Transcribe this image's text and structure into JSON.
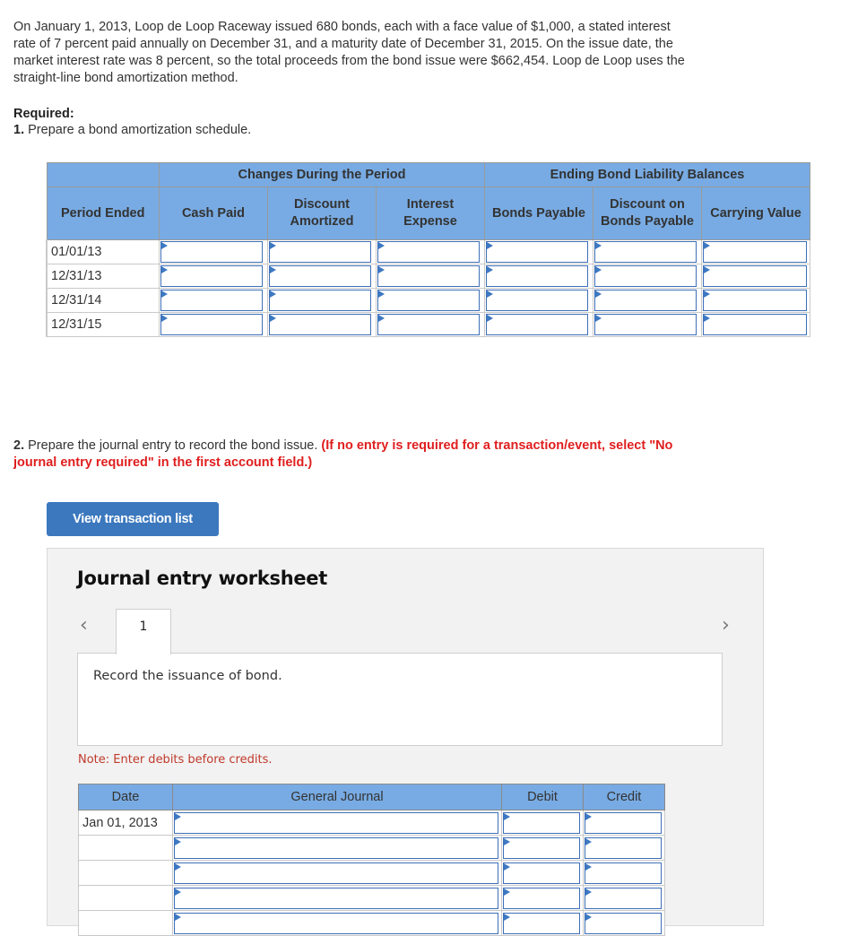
{
  "intro": "On January 1, 2013, Loop de Loop Raceway issued 680 bonds, each with a face value of $1,000, a stated interest rate of 7 percent paid annually on December 31, and a maturity date of December 31, 2015. On the issue date, the market interest rate was 8 percent, so the total proceeds from the bond issue were $662,454. Loop de Loop uses the straight-line bond amortization method.",
  "required": {
    "title": "Required:",
    "item1_number": "1.",
    "item1_text": "Prepare a bond amortization schedule."
  },
  "schedule": {
    "group_headers": [
      "Changes During the Period",
      "Ending Bond Liability Balances"
    ],
    "columns": [
      "Period Ended",
      "Cash Paid",
      "Discount Amortized",
      "Interest Expense",
      "Bonds Payable",
      "Discount on Bonds Payable",
      "Carrying Value"
    ],
    "rows": [
      {
        "period": "01/01/13",
        "values": [
          "",
          "",
          "",
          "",
          "",
          ""
        ]
      },
      {
        "period": "12/31/13",
        "values": [
          "",
          "",
          "",
          "",
          "",
          ""
        ]
      },
      {
        "period": "12/31/14",
        "values": [
          "",
          "",
          "",
          "",
          "",
          ""
        ]
      },
      {
        "period": "12/31/15",
        "values": [
          "",
          "",
          "",
          "",
          "",
          ""
        ]
      }
    ]
  },
  "part2": {
    "number": "2.",
    "text": "Prepare the journal entry to record the bond issue.",
    "instruction": "(If no entry is required for a transaction/event, select \"No journal entry required\" in the first account field.)"
  },
  "view_transaction_button": "View transaction list",
  "worksheet": {
    "title": "Journal entry worksheet",
    "prev_icon": "‹",
    "next_icon": "›",
    "tabs": [
      "1"
    ],
    "instruction": "Record the issuance of bond.",
    "note": "Note: Enter debits before credits.",
    "journal": {
      "columns": [
        "Date",
        "General Journal",
        "Debit",
        "Credit"
      ],
      "rows": [
        {
          "date": "Jan 01, 2013",
          "account": "",
          "debit": "",
          "credit": ""
        },
        {
          "date": "",
          "account": "",
          "debit": "",
          "credit": ""
        },
        {
          "date": "",
          "account": "",
          "debit": "",
          "credit": ""
        },
        {
          "date": "",
          "account": "",
          "debit": "",
          "credit": ""
        },
        {
          "date": "",
          "account": "",
          "debit": "",
          "credit": ""
        }
      ]
    }
  }
}
